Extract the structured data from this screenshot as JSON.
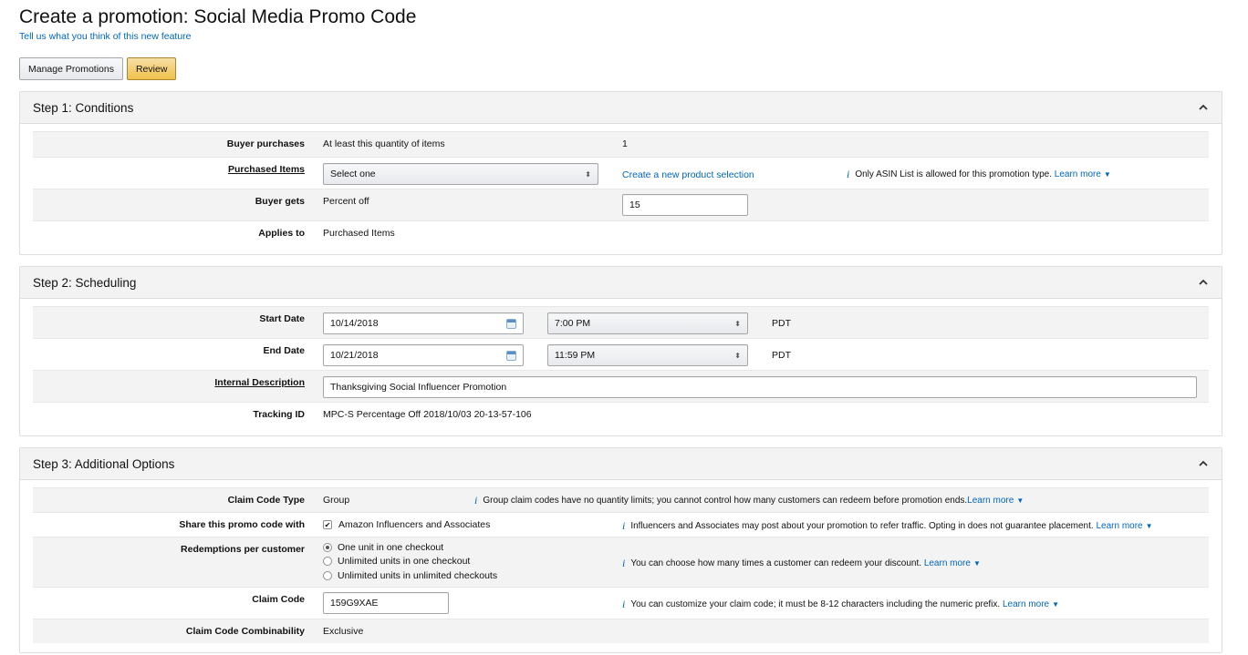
{
  "page": {
    "title": "Create a promotion: Social Media Promo Code",
    "feedback_link": "Tell us what you think of this new feature"
  },
  "actions": {
    "manage_label": "Manage Promotions",
    "review_label": "Review"
  },
  "colors": {
    "link": "#0066c0",
    "primary_button": "#f0c14b",
    "section_header_bg": "#f3f3f3"
  },
  "step1": {
    "title": "Step 1: Conditions",
    "buyer_purchases_label": "Buyer purchases",
    "buyer_purchases_value": "At least this quantity of items",
    "quantity_value": "1",
    "purchased_items_label": "Purchased Items",
    "purchased_items_select": "Select one",
    "create_selection_link": "Create a new product selection",
    "asin_note": "Only ASIN List is allowed for this promotion type.",
    "learn_more": "Learn more",
    "buyer_gets_label": "Buyer gets",
    "buyer_gets_value": "Percent off",
    "percent_value": "15",
    "applies_to_label": "Applies to",
    "applies_to_value": "Purchased Items"
  },
  "step2": {
    "title": "Step 2: Scheduling",
    "start_date_label": "Start Date",
    "start_date_value": "10/14/2018",
    "start_time_value": "7:00 PM",
    "start_tz": "PDT",
    "end_date_label": "End Date",
    "end_date_value": "10/21/2018",
    "end_time_value": "11:59 PM",
    "end_tz": "PDT",
    "internal_desc_label": "Internal Description",
    "internal_desc_value": "Thanksgiving Social Influencer Promotion",
    "tracking_id_label": "Tracking ID",
    "tracking_id_value": "MPC-S Percentage Off 2018/10/03 20-13-57-106"
  },
  "step3": {
    "title": "Step 3: Additional Options",
    "claim_type_label": "Claim Code Type",
    "claim_type_value": "Group",
    "claim_type_note": "Group claim codes have no quantity limits; you cannot control how many customers can redeem before promotion ends.",
    "share_label": "Share this promo code with",
    "share_value": "Amazon Influencers and Associates",
    "share_note": "Influencers and Associates may post about your promotion to refer traffic. Opting in does not guarantee placement.",
    "redemptions_label": "Redemptions per customer",
    "redemption_options": [
      "One unit in one checkout",
      "Unlimited units in one checkout",
      "Unlimited units in unlimited checkouts"
    ],
    "redemptions_note": "You can choose how many times a customer can redeem your discount.",
    "claim_code_label": "Claim Code",
    "claim_code_value": "159G9XAE",
    "claim_code_note": "You can customize your claim code; it must be 8-12 characters including the numeric prefix.",
    "combinability_label": "Claim Code Combinability",
    "combinability_value": "Exclusive",
    "learn_more": "Learn more"
  }
}
